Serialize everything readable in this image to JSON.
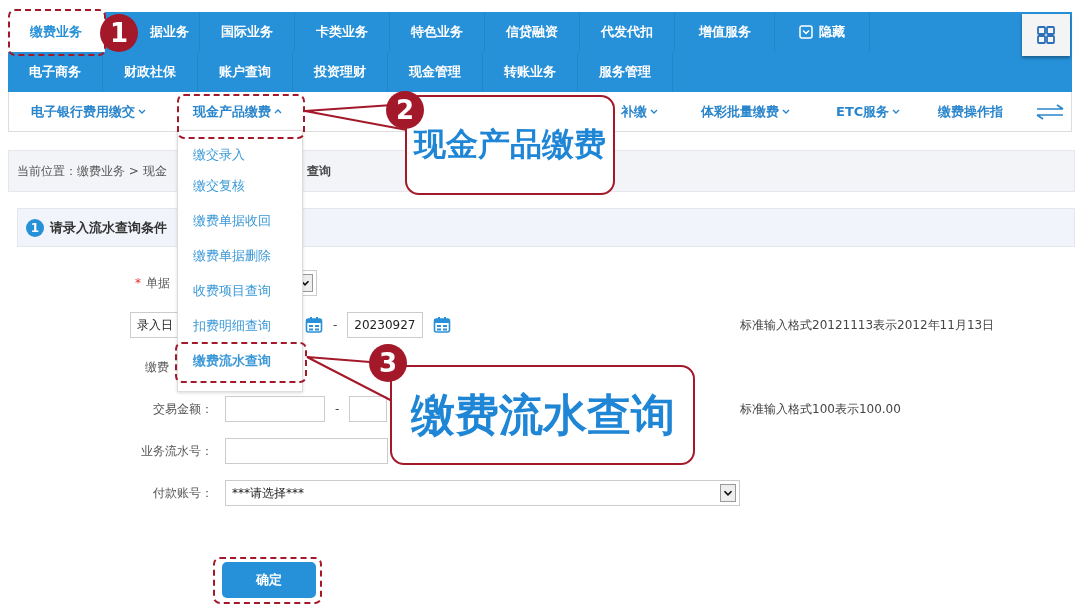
{
  "nav": {
    "rows": [
      [
        {
          "label": "缴费业务",
          "selected": true,
          "kind": "tab"
        },
        {
          "label": "据业务",
          "selected": false,
          "kind": "tab"
        },
        {
          "label": "国际业务",
          "selected": false,
          "kind": "tab"
        },
        {
          "label": "卡类业务",
          "selected": false,
          "kind": "tab"
        },
        {
          "label": "特色业务",
          "selected": false,
          "kind": "tab"
        },
        {
          "label": "信贷融资",
          "selected": false,
          "kind": "tab"
        },
        {
          "label": "代发代扣",
          "selected": false,
          "kind": "tab"
        },
        {
          "label": "增值服务",
          "selected": false,
          "kind": "tab"
        },
        {
          "label": "隐藏",
          "selected": false,
          "kind": "toggle"
        }
      ],
      [
        {
          "label": "电子商务",
          "selected": false,
          "kind": "tab"
        },
        {
          "label": "财政社保",
          "selected": false,
          "kind": "tab"
        },
        {
          "label": "账户查询",
          "selected": false,
          "kind": "tab"
        },
        {
          "label": "投资理财",
          "selected": false,
          "kind": "tab"
        },
        {
          "label": "现金管理",
          "selected": false,
          "kind": "tab"
        },
        {
          "label": "转账业务",
          "selected": false,
          "kind": "tab"
        },
        {
          "label": "服务管理",
          "selected": false,
          "kind": "tab"
        }
      ]
    ]
  },
  "subnav": [
    {
      "label": "电子银行费用缴交",
      "expanded": false
    },
    {
      "label": "现金产品缴费",
      "expanded": true
    },
    {
      "label": "补缴",
      "expanded": false
    },
    {
      "label": "体彩批量缴费",
      "expanded": false
    },
    {
      "label": "ETC服务",
      "expanded": false
    },
    {
      "label": "缴费操作指"
    }
  ],
  "dropdown": [
    {
      "label": "缴交录入",
      "selected": false
    },
    {
      "label": "缴交复核",
      "selected": false
    },
    {
      "label": "缴费单据收回",
      "selected": false
    },
    {
      "label": "缴费单据删除",
      "selected": false
    },
    {
      "label": "收费项目查询",
      "selected": false
    },
    {
      "label": "扣费明细查询",
      "selected": false
    },
    {
      "label": "缴费流水查询",
      "selected": true
    }
  ],
  "breadcrumb": {
    "start": "当前位置：缴费业务 > 现金",
    "end": "查询"
  },
  "section": {
    "number": "1",
    "title": "请录入流水查询条件"
  },
  "form": [
    {
      "kind": "status",
      "label": "单据",
      "required": true,
      "required_mark": "*"
    },
    {
      "kind": "date_range",
      "select_value": "录入日",
      "separator": "-",
      "end_value": "20230927",
      "hint": "标准输入格式20121113表示2012年11月13日"
    },
    {
      "kind": "cut",
      "label": "缴费"
    },
    {
      "kind": "amount_range",
      "label": "交易金额：",
      "separator": "-",
      "hint": "标准输入格式100表示100.00"
    },
    {
      "kind": "text",
      "label": "业务流水号："
    },
    {
      "kind": "select",
      "label": "付款账号：",
      "value": "***请选择***"
    }
  ],
  "submit": "确定",
  "annotations": [
    {
      "number": "1"
    },
    {
      "number": "2",
      "callout": "现金产品缴费"
    },
    {
      "number": "3",
      "callout": "缴费流水查询"
    }
  ]
}
